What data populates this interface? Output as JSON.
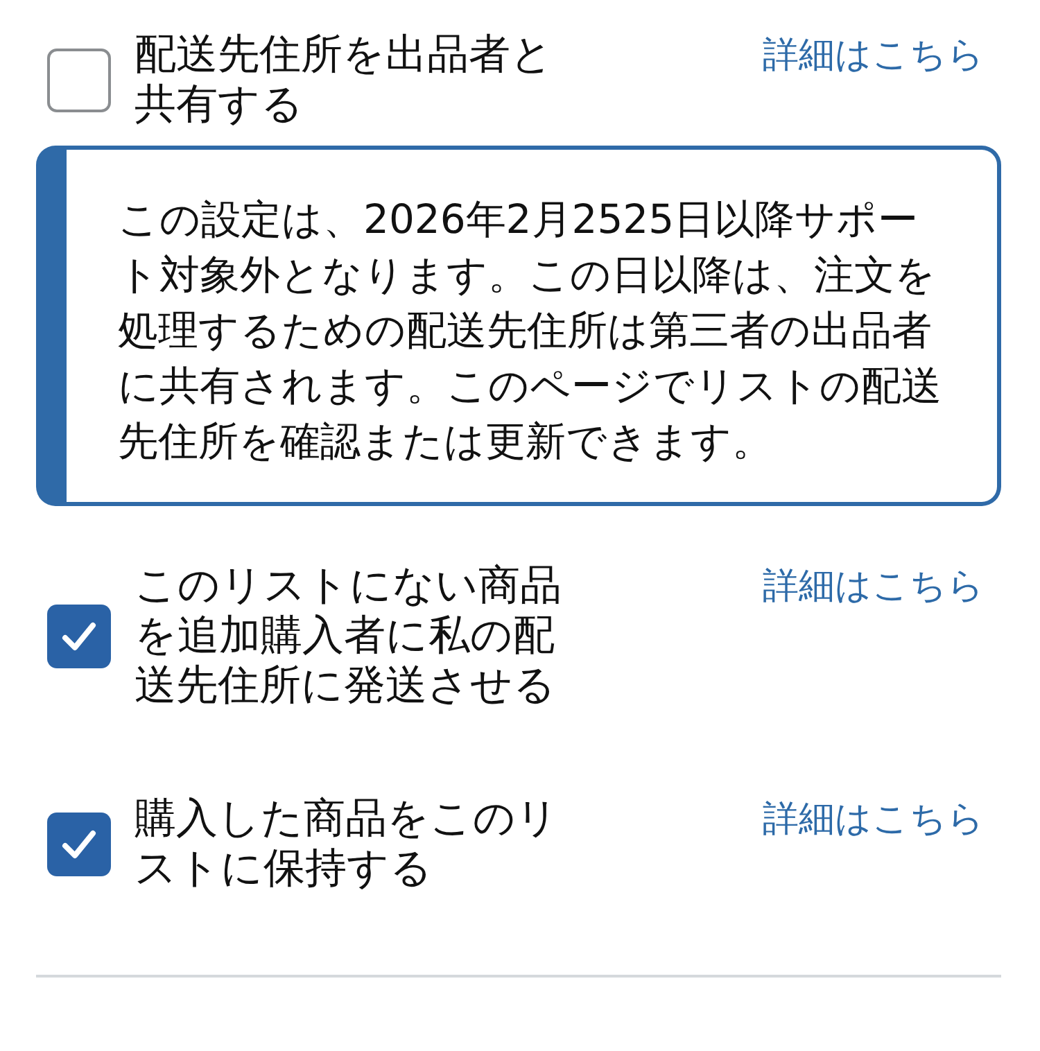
{
  "items": [
    {
      "kind": "setting",
      "label": "配送先住所を出品者と共有する",
      "checked": false,
      "link": "詳細はこちら"
    },
    {
      "kind": "notice",
      "text": "この設定は、2026年2月2525日以降サポート対象外となります。この日以降は、注文を処理するための配送先住所は第三者の出品者に共有されます。このページでリストの配送先住所を確認または更新できます。"
    },
    {
      "kind": "setting",
      "label": "このリストにない商品を追加購入者に私の配送先住所に発送させる",
      "checked": true,
      "link": "詳細はこちら"
    },
    {
      "kind": "setting",
      "label": "購入した商品をこのリストに保持する",
      "checked": true,
      "link": "詳細はこちら"
    }
  ]
}
